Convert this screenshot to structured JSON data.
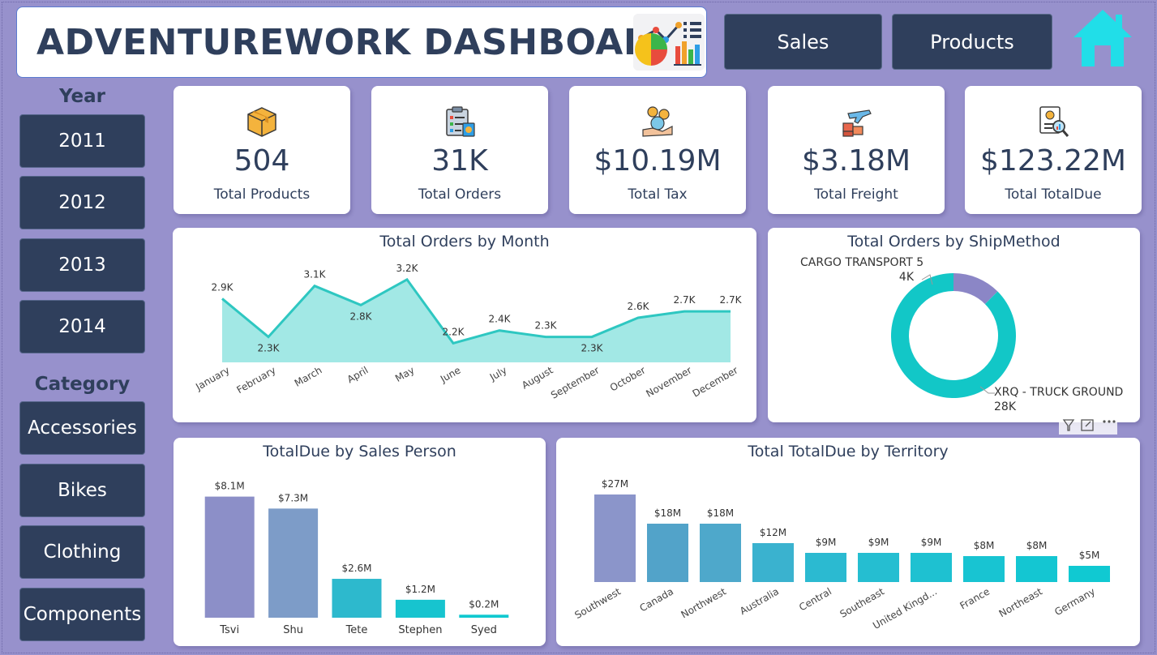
{
  "header": {
    "title": "ADVENTUREWORK DASHBOARD"
  },
  "nav": {
    "sales_label": "Sales",
    "products_label": "Products"
  },
  "slicers": {
    "year_title": "Year",
    "years": [
      "2011",
      "2012",
      "2013",
      "2014"
    ],
    "category_title": "Category",
    "categories": [
      "Accessories",
      "Bikes",
      "Clothing",
      "Components"
    ]
  },
  "kpis": [
    {
      "value": "504",
      "label": "Total Products",
      "icon": "package-icon"
    },
    {
      "value": "31K",
      "label": "Total Orders",
      "icon": "clipboard-icon"
    },
    {
      "value": "$10.19M",
      "label": "Total Tax",
      "icon": "tax-icon"
    },
    {
      "value": "$3.18M",
      "label": "Total Freight",
      "icon": "freight-icon"
    },
    {
      "value": "$123.22M",
      "label": "Total TotalDue",
      "icon": "invoice-icon"
    }
  ],
  "colors": {
    "background": "#9791cc",
    "navy": "#2f3f5c",
    "teal": "#2ec7c1",
    "area_fill": "#a2e8e5",
    "cyan_home": "#21dee8"
  },
  "chart_data": [
    {
      "type": "area",
      "title": "Total Orders by Month",
      "categories": [
        "January",
        "February",
        "March",
        "April",
        "May",
        "June",
        "July",
        "August",
        "September",
        "October",
        "November",
        "December"
      ],
      "values": [
        2900,
        2300,
        3100,
        2800,
        3200,
        2200,
        2400,
        2300,
        2300,
        2600,
        2700,
        2700
      ],
      "labels": [
        "2.9K",
        "2.3K",
        "3.1K",
        "2.8K",
        "3.2K",
        "2.2K",
        "2.4K",
        "2.3K",
        "2.3K",
        "2.6K",
        "2.7K",
        "2.7K"
      ],
      "ylim": [
        1900,
        3300
      ]
    },
    {
      "type": "pie",
      "title": "Total Orders by ShipMethod",
      "categories": [
        "CARGO TRANSPORT 5",
        "XRQ - TRUCK GROUND"
      ],
      "values": [
        4000,
        28000
      ],
      "labels": [
        "4K",
        "28K"
      ],
      "colors": [
        "#8b86c6",
        "#12c7c7"
      ]
    },
    {
      "type": "bar",
      "title": "TotalDue by Sales Person",
      "categories": [
        "Tsvi",
        "Shu",
        "Tete",
        "Stephen",
        "Syed"
      ],
      "values": [
        8.1,
        7.3,
        2.6,
        1.2,
        0.2
      ],
      "labels": [
        "$8.1M",
        "$7.3M",
        "$2.6M",
        "$1.2M",
        "$0.2M"
      ],
      "colors": [
        "#8c8fc8",
        "#7d9cc8",
        "#2db9cd",
        "#17c4cf",
        "#10c9d0"
      ],
      "ylim": [
        0,
        9
      ]
    },
    {
      "type": "bar",
      "title": "Total TotalDue by Territory",
      "categories": [
        "Southwest",
        "Canada",
        "Northwest",
        "Australia",
        "Central",
        "Southeast",
        "United Kingd...",
        "France",
        "Northeast",
        "Germany"
      ],
      "values": [
        27,
        18,
        18,
        12,
        9,
        9,
        9,
        8,
        8,
        5
      ],
      "labels": [
        "$27M",
        "$18M",
        "$18M",
        "$12M",
        "$9M",
        "$9M",
        "$9M",
        "$8M",
        "$8M",
        "$5M"
      ],
      "colors": [
        "#8b95ca",
        "#52a3c9",
        "#4ea8cb",
        "#3ab2cf",
        "#2bbad1",
        "#25bed1",
        "#1ec1d1",
        "#18c4d2",
        "#14c6d2",
        "#10c9d2"
      ],
      "ylim": [
        0,
        30
      ]
    }
  ]
}
